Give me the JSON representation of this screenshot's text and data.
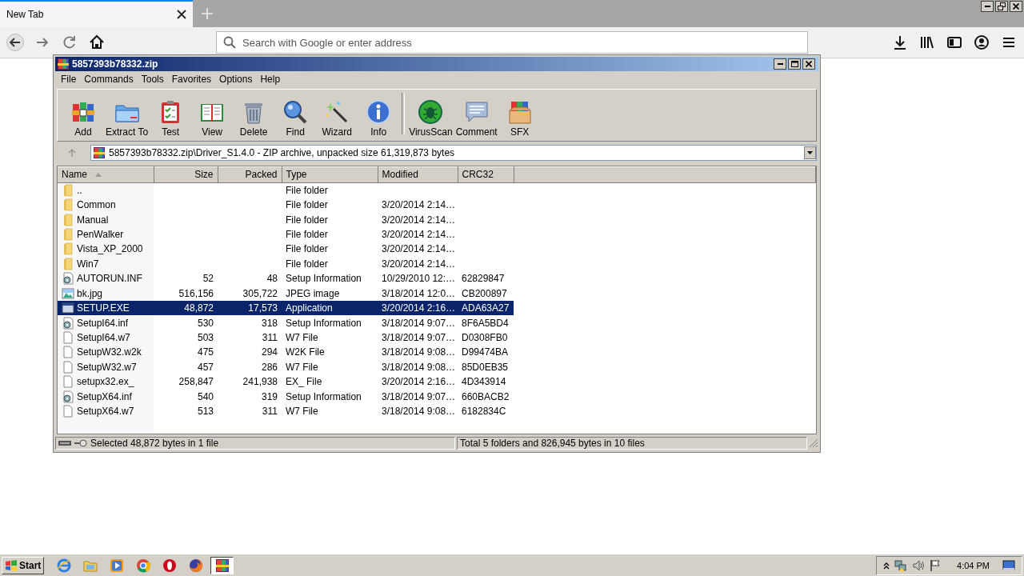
{
  "browser": {
    "tabs": [
      {
        "title": "New Tab",
        "selected": true
      }
    ],
    "address": {
      "placeholder": "Search with Google or enter address"
    }
  },
  "archiver": {
    "title": "5857393b78332.zip",
    "menu": [
      "File",
      "Commands",
      "Tools",
      "Favorites",
      "Options",
      "Help"
    ],
    "toolbar": [
      {
        "label": "Add",
        "kind": "add",
        "separator_before": false
      },
      {
        "label": "Extract To",
        "kind": "extract",
        "separator_before": false
      },
      {
        "label": "Test",
        "kind": "test",
        "separator_before": false
      },
      {
        "label": "View",
        "kind": "view",
        "separator_before": false
      },
      {
        "label": "Delete",
        "kind": "delete",
        "separator_before": false
      },
      {
        "label": "Find",
        "kind": "find",
        "separator_before": false
      },
      {
        "label": "Wizard",
        "kind": "wizard",
        "separator_before": false
      },
      {
        "label": "Info",
        "kind": "info",
        "separator_before": false
      },
      {
        "label": "VirusScan",
        "kind": "virus",
        "separator_before": true
      },
      {
        "label": "Comment",
        "kind": "comment",
        "separator_before": false
      },
      {
        "label": "SFX",
        "kind": "sfx",
        "separator_before": false
      }
    ],
    "path": "5857393b78332.zip\\Driver_S1.4.0 - ZIP archive, unpacked size 61,319,873 bytes",
    "columns": [
      {
        "label": "Name",
        "sorted": true
      },
      {
        "label": "Size",
        "sorted": false
      },
      {
        "label": "Packed",
        "sorted": false
      },
      {
        "label": "Type",
        "sorted": false
      },
      {
        "label": "Modified",
        "sorted": false
      },
      {
        "label": "CRC32",
        "sorted": false
      }
    ],
    "rows": [
      {
        "name": "..",
        "size": "",
        "packed": "",
        "type": "File folder",
        "modified": "",
        "crc32": "",
        "kind": "folder",
        "selected": false
      },
      {
        "name": "Common",
        "size": "",
        "packed": "",
        "type": "File folder",
        "modified": "3/20/2014 2:14…",
        "crc32": "",
        "kind": "folder",
        "selected": false
      },
      {
        "name": "Manual",
        "size": "",
        "packed": "",
        "type": "File folder",
        "modified": "3/20/2014 2:14…",
        "crc32": "",
        "kind": "folder",
        "selected": false
      },
      {
        "name": "PenWalker",
        "size": "",
        "packed": "",
        "type": "File folder",
        "modified": "3/20/2014 2:14…",
        "crc32": "",
        "kind": "folder",
        "selected": false
      },
      {
        "name": "Vista_XP_2000",
        "size": "",
        "packed": "",
        "type": "File folder",
        "modified": "3/20/2014 2:14…",
        "crc32": "",
        "kind": "folder",
        "selected": false
      },
      {
        "name": "Win7",
        "size": "",
        "packed": "",
        "type": "File folder",
        "modified": "3/20/2014 2:14…",
        "crc32": "",
        "kind": "folder",
        "selected": false
      },
      {
        "name": "AUTORUN.INF",
        "size": "52",
        "packed": "48",
        "type": "Setup Information",
        "modified": "10/29/2010 12:…",
        "crc32": "62829847",
        "kind": "setup",
        "selected": false
      },
      {
        "name": "bk.jpg",
        "size": "516,156",
        "packed": "305,722",
        "type": "JPEG image",
        "modified": "3/18/2014 12:0…",
        "crc32": "CB200897",
        "kind": "image",
        "selected": false
      },
      {
        "name": "SETUP.EXE",
        "size": "48,872",
        "packed": "17,573",
        "type": "Application",
        "modified": "3/20/2014 2:16…",
        "crc32": "ADA63A27",
        "kind": "exe",
        "selected": true
      },
      {
        "name": "SetupI64.inf",
        "size": "530",
        "packed": "318",
        "type": "Setup Information",
        "modified": "3/18/2014 9:07…",
        "crc32": "8F6A5BD4",
        "kind": "setup",
        "selected": false
      },
      {
        "name": "SetupI64.w7",
        "size": "503",
        "packed": "311",
        "type": "W7 File",
        "modified": "3/18/2014 9:07…",
        "crc32": "D0308FB0",
        "kind": "file",
        "selected": false
      },
      {
        "name": "SetupW32.w2k",
        "size": "475",
        "packed": "294",
        "type": "W2K File",
        "modified": "3/18/2014 9:08…",
        "crc32": "D99474BA",
        "kind": "file",
        "selected": false
      },
      {
        "name": "SetupW32.w7",
        "size": "457",
        "packed": "286",
        "type": "W7 File",
        "modified": "3/18/2014 9:08…",
        "crc32": "85D0EB35",
        "kind": "file",
        "selected": false
      },
      {
        "name": "setupx32.ex_",
        "size": "258,847",
        "packed": "241,938",
        "type": "EX_ File",
        "modified": "3/20/2014 2:16…",
        "crc32": "4D343914",
        "kind": "file",
        "selected": false
      },
      {
        "name": "SetupX64.inf",
        "size": "540",
        "packed": "319",
        "type": "Setup Information",
        "modified": "3/18/2014 9:07…",
        "crc32": "660BACB2",
        "kind": "setup",
        "selected": false
      },
      {
        "name": "SetupX64.w7",
        "size": "513",
        "packed": "311",
        "type": "W7 File",
        "modified": "3/18/2014 9:08…",
        "crc32": "6182834C",
        "kind": "file",
        "selected": false
      }
    ],
    "status_left": "Selected 48,872 bytes in 1 file",
    "status_right": "Total 5 folders and 826,945 bytes in 10 files"
  },
  "taskbar": {
    "start": "Start",
    "apps": [
      {
        "kind": "ie",
        "selected": false
      },
      {
        "kind": "explorer",
        "selected": false
      },
      {
        "kind": "media",
        "selected": false
      },
      {
        "kind": "chrome",
        "selected": false
      },
      {
        "kind": "opera",
        "selected": false
      },
      {
        "kind": "firefox",
        "selected": false
      },
      {
        "kind": "archiver",
        "selected": true
      }
    ],
    "clock": "4:04 PM"
  }
}
